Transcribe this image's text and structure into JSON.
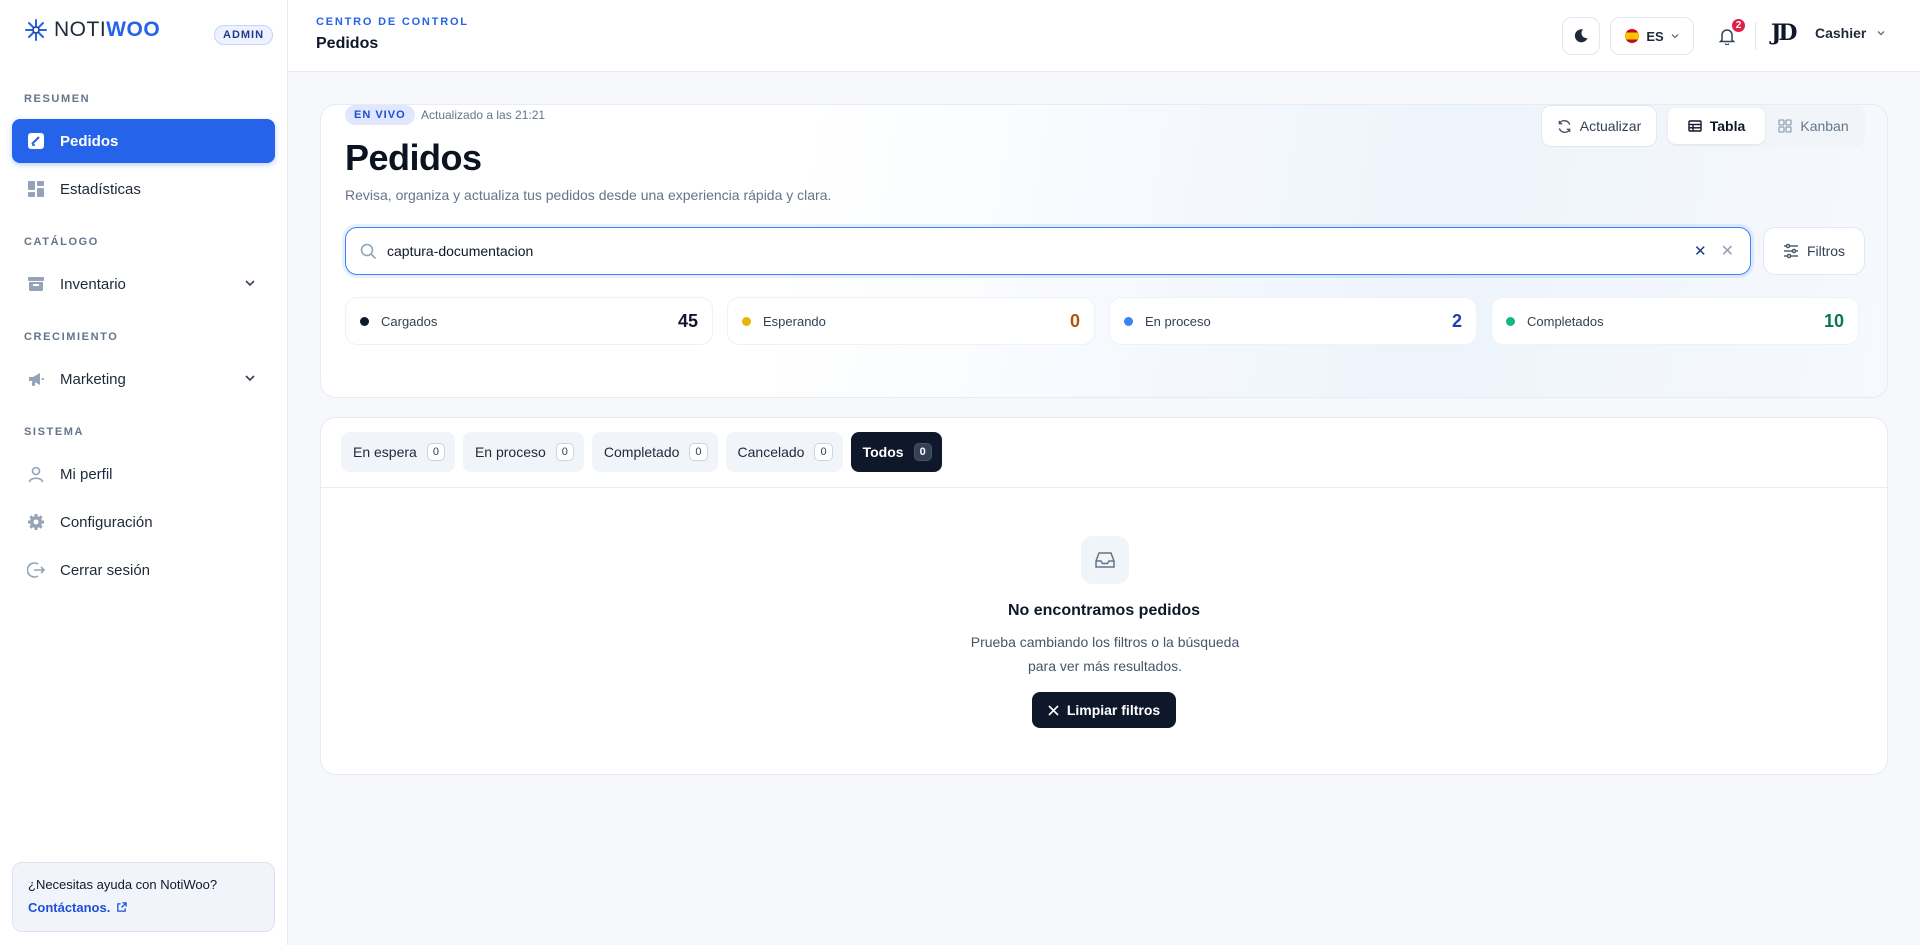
{
  "brand": {
    "name_prefix": "NOTI",
    "name_suffix": "WOO",
    "role_badge": "ADMIN"
  },
  "sidebar": {
    "sections": {
      "resumen": "RESUMEN",
      "catalogo": "CATÁLOGO",
      "crecimiento": "CRECIMIENTO",
      "sistema": "SISTEMA"
    },
    "items": {
      "pedidos": "Pedidos",
      "estadisticas": "Estadísticas",
      "inventario": "Inventario",
      "marketing": "Marketing",
      "perfil": "Mi perfil",
      "configuracion": "Configuración",
      "cerrar": "Cerrar sesión"
    },
    "help": {
      "question": "¿Necesitas ayuda con NotiWoo?",
      "link": "Contáctanos."
    }
  },
  "header": {
    "kicker": "CENTRO DE CONTROL",
    "title": "Pedidos",
    "language": "ES",
    "notifications_count": "2",
    "user_initials": "JD",
    "user_name": "Cashier"
  },
  "summary": {
    "live_badge": "EN VIVO",
    "updated": "Actualizado a las 21:21",
    "title": "Pedidos",
    "subtitle": "Revisa, organiza y actualiza tus pedidos desde una experiencia rápida y clara.",
    "refresh_label": "Actualizar",
    "view_table": "Tabla",
    "view_kanban": "Kanban",
    "search_value": "captura-documentacion",
    "filters_label": "Filtros",
    "stats": [
      {
        "label": "Cargados",
        "value": "45",
        "color": "#0f172a"
      },
      {
        "label": "Esperando",
        "value": "0",
        "color": "#eab308"
      },
      {
        "label": "En proceso",
        "value": "2",
        "color": "#3b82f6"
      },
      {
        "label": "Completados",
        "value": "10",
        "color": "#10b981"
      }
    ]
  },
  "orders": {
    "tabs": [
      {
        "label": "En espera",
        "count": "0"
      },
      {
        "label": "En proceso",
        "count": "0"
      },
      {
        "label": "Completado",
        "count": "0"
      },
      {
        "label": "Cancelado",
        "count": "0"
      },
      {
        "label": "Todos",
        "count": "0"
      }
    ],
    "empty_title": "No encontramos pedidos",
    "empty_desc": "Prueba cambiando los filtros o la búsqueda para ver más resultados.",
    "clear_filters": "Limpiar filtros"
  },
  "colors": {
    "primary": "#2563eb",
    "dark": "#0f172a",
    "stat_value_colors": [
      "#0f172a",
      "#b45309",
      "#1e40af",
      "#047857"
    ]
  }
}
